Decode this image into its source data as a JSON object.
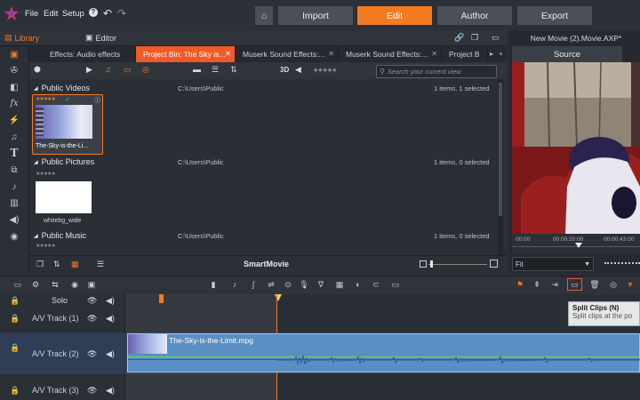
{
  "menu": {
    "file": "File",
    "edit": "Edit",
    "setup": "Setup",
    "help": "?"
  },
  "main_tabs": {
    "import": "Import",
    "edit": "Edit",
    "author": "Author",
    "export": "Export"
  },
  "library_header": {
    "library": "Library",
    "editor": "Editor"
  },
  "preview": {
    "title": "New Movie (2).Movie.AXP*",
    "source": "Source",
    "fit": "Fit",
    "ruler": [
      "00:00",
      "00:00:20:00",
      "00:00:43:00"
    ]
  },
  "tabs": [
    {
      "label": "Effects: Audio effects",
      "active": false
    },
    {
      "label": "Project Bin: The Sky is...",
      "active": true
    },
    {
      "label": "Muserk Sound Effects:...",
      "active": false
    },
    {
      "label": "Muserk Sound Effects:...",
      "active": false
    },
    {
      "label": "Project B",
      "active": false
    }
  ],
  "toolbar": {
    "label_3d": "3D",
    "search_placeholder": "Search your current view"
  },
  "sections": [
    {
      "title": "Public Videos",
      "path": "C:\\Users\\Public",
      "count": "1 items, 1 selected"
    },
    {
      "title": "Public Pictures",
      "path": "C:\\Users\\Public",
      "count": "1 items, 0 selected"
    },
    {
      "title": "Public Music",
      "path": "C:\\Users\\Public",
      "count": "1 items, 0 selected"
    }
  ],
  "items": [
    {
      "name": "The-Sky-is-the-Li..."
    },
    {
      "name": "whitebg_wide"
    }
  ],
  "library_footer": {
    "smartmovie": "SmartMovie"
  },
  "timeline": {
    "solo": "Solo",
    "tracks": [
      "A/V Track (1)",
      "A/V Track (2)",
      "A/V Track (3)"
    ],
    "clip_name": "The-Sky-is-the-Limit.mpg",
    "tooltip_title": "Split Clips (N)",
    "tooltip_desc": "Split clips at the po"
  },
  "colors": {
    "accent": "#f47b20",
    "clip": "#5a8fc4",
    "background": "#2b2f36"
  }
}
